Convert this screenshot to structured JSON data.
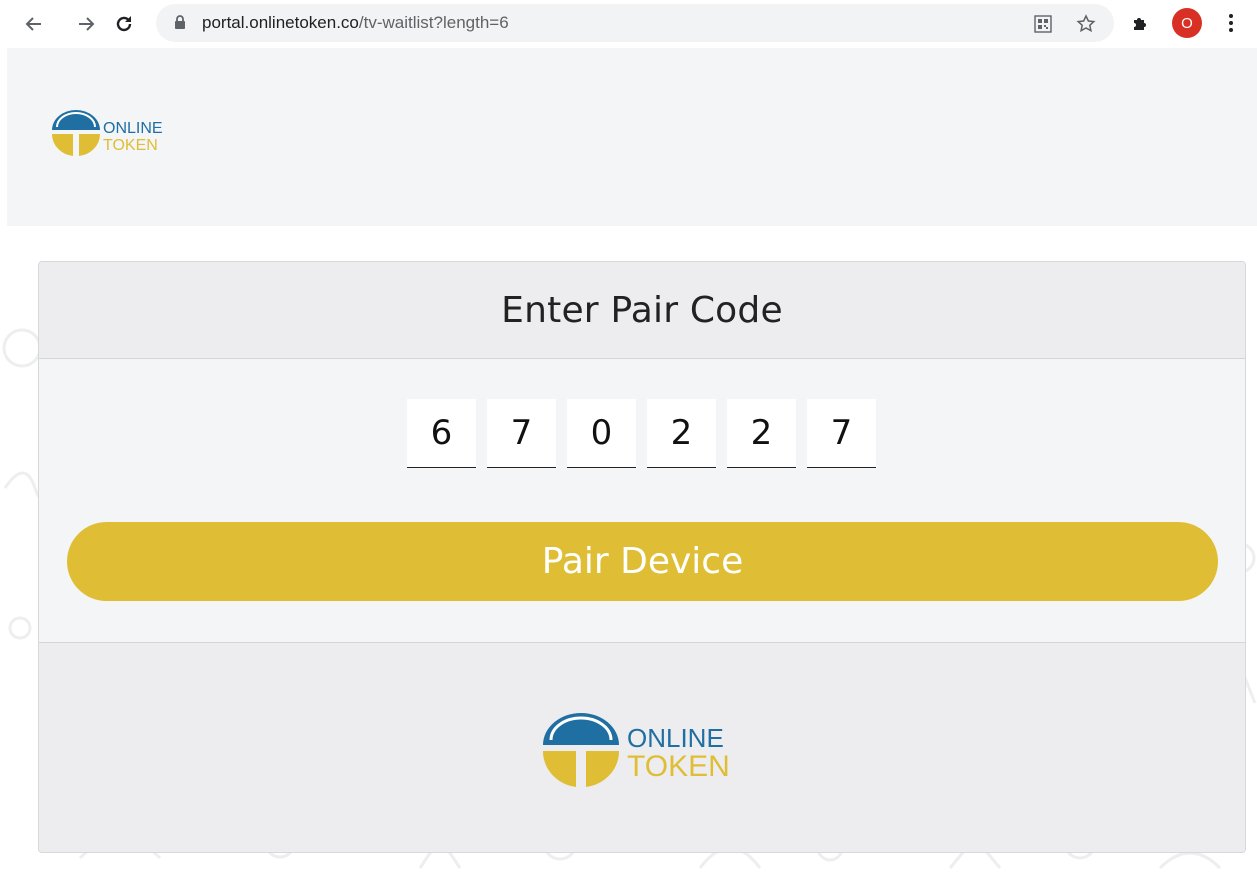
{
  "browser": {
    "url_host": "portal.onlinetoken.co",
    "url_path": "/tv-waitlist?length=6",
    "profile_initial": "O"
  },
  "brand": {
    "line1": "ONLINE",
    "line2": "TOKEN",
    "colors": {
      "blue": "#1f6fa3",
      "dark_blue": "#0f4d78",
      "gold": "#dfbe35"
    }
  },
  "card": {
    "title": "Enter Pair Code",
    "digits": [
      "6",
      "7",
      "0",
      "2",
      "2",
      "7"
    ],
    "button_label": "Pair Device"
  }
}
